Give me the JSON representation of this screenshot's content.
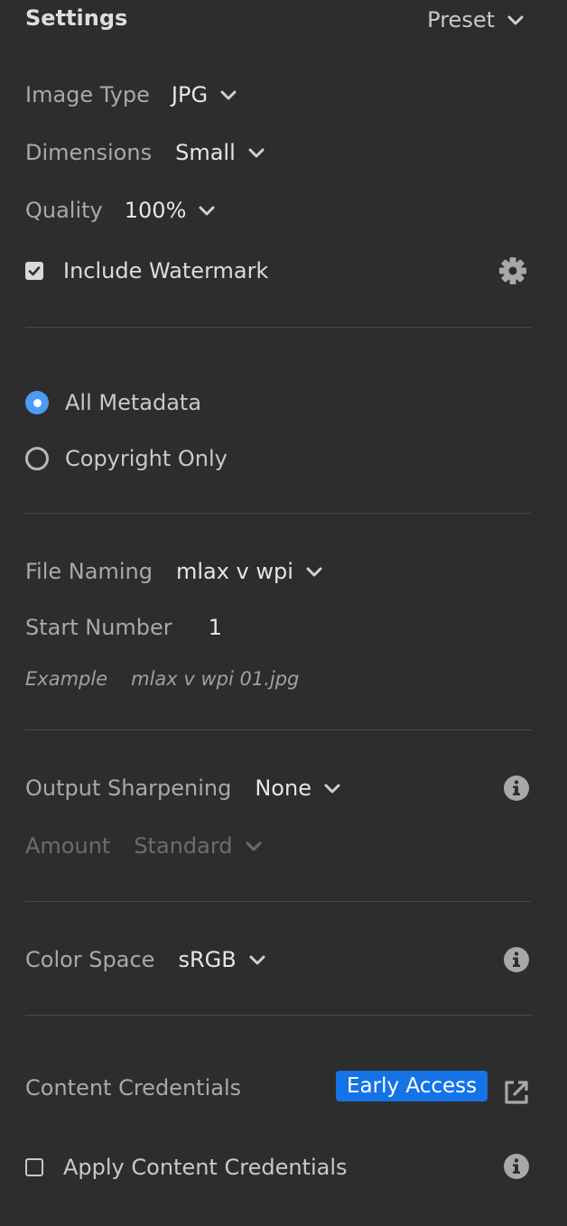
{
  "header": {
    "title": "Settings",
    "preset_label": "Preset"
  },
  "image_settings": {
    "image_type": {
      "label": "Image Type",
      "value": "JPG"
    },
    "dimensions": {
      "label": "Dimensions",
      "value": "Small"
    },
    "quality": {
      "label": "Quality",
      "value": "100%"
    },
    "watermark": {
      "label": "Include Watermark",
      "checked": true
    }
  },
  "metadata": {
    "options": [
      {
        "label": "All Metadata",
        "selected": true
      },
      {
        "label": "Copyright Only",
        "selected": false
      }
    ]
  },
  "file_naming": {
    "label": "File Naming",
    "value": "mlax v wpi",
    "start_number_label": "Start Number",
    "start_number": "1",
    "example_label": "Example",
    "example_value": "mlax v wpi 01.jpg"
  },
  "sharpening": {
    "label": "Output Sharpening",
    "value": "None",
    "amount_label": "Amount",
    "amount_value": "Standard"
  },
  "color_space": {
    "label": "Color Space",
    "value": "sRGB"
  },
  "content_credentials": {
    "label": "Content Credentials",
    "badge": "Early Access",
    "apply_label": "Apply Content Credentials",
    "apply_checked": false
  },
  "colors": {
    "accent": "#1473e6",
    "radio_on": "#4b9cf5",
    "background": "#2d2d2d"
  },
  "icons": [
    "chevron-down-icon",
    "gear-icon",
    "info-icon",
    "external-link-icon",
    "checkmark-icon"
  ]
}
